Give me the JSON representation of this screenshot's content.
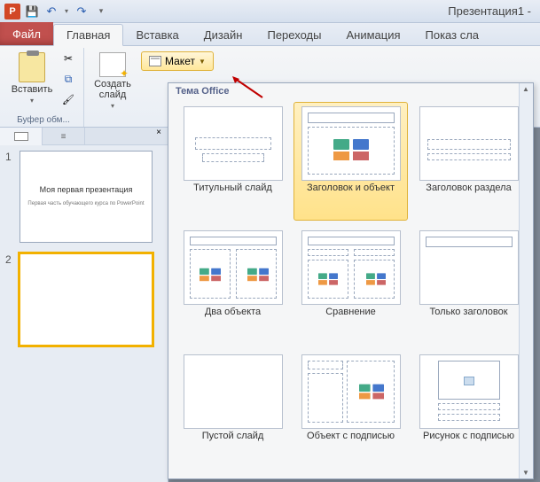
{
  "window": {
    "title": "Презентация1 -"
  },
  "tabs": {
    "file": "Файл",
    "items": [
      "Главная",
      "Вставка",
      "Дизайн",
      "Переходы",
      "Анимация",
      "Показ сла"
    ],
    "active": 0
  },
  "ribbon": {
    "clipboard": {
      "title": "Буфер обм...",
      "paste": "Вставить"
    },
    "slides": {
      "newSlide": "Создать\nслайд",
      "layout": "Макет"
    }
  },
  "gallery": {
    "header": "Тема Office",
    "selected": 1,
    "items": [
      "Титульный слайд",
      "Заголовок и объект",
      "Заголовок раздела",
      "Два объекта",
      "Сравнение",
      "Только заголовок",
      "Пустой слайд",
      "Объект с подписью",
      "Рисунок с подписью"
    ]
  },
  "thumbs": {
    "selected": 2,
    "slide1": {
      "title": "Моя первая презентация",
      "sub": "Первая часть обучающего курса по PowerPoint"
    }
  }
}
